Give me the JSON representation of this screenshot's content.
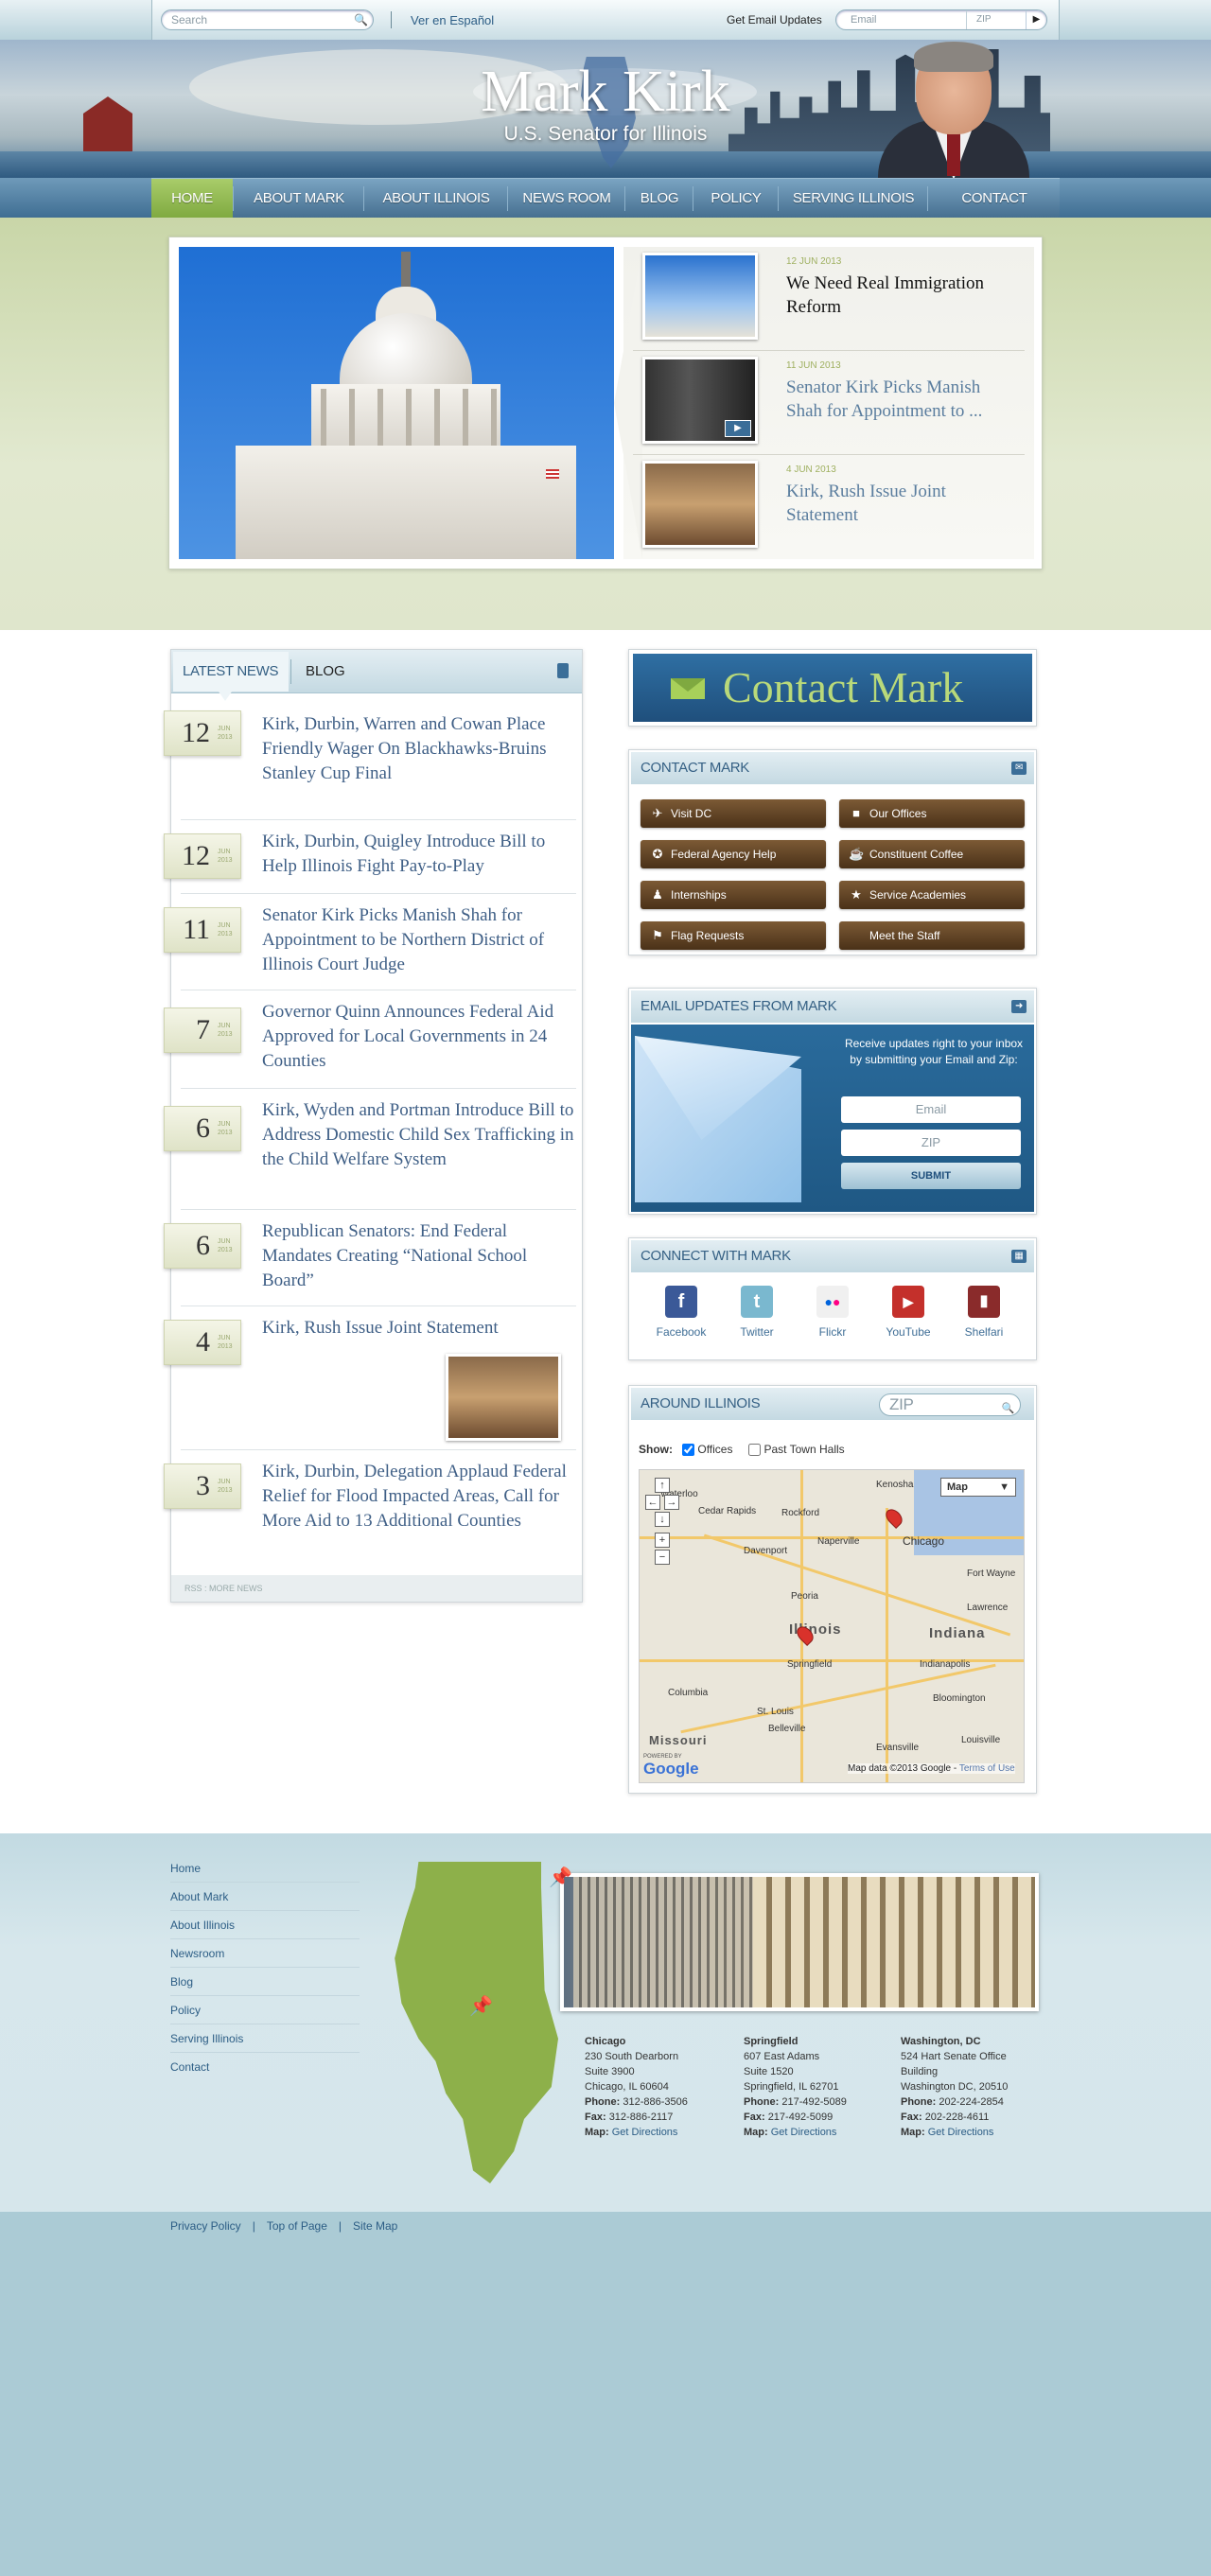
{
  "topbar": {
    "search_placeholder": "Search",
    "espanol": "Ver en Español",
    "email_label": "Get Email Updates",
    "email_placeholder": "Email",
    "zip_placeholder": "ZIP"
  },
  "header": {
    "name": "Mark Kirk",
    "tagline": "U.S. Senator for Illinois"
  },
  "nav": [
    "HOME",
    "ABOUT MARK",
    "ABOUT ILLINOIS",
    "NEWS ROOM",
    "BLOG",
    "POLICY",
    "SERVING ILLINOIS",
    "CONTACT"
  ],
  "featured": [
    {
      "date": "12 JUN 2013",
      "title": "We Need Real Immigration Reform"
    },
    {
      "date": "11 JUN 2013",
      "title": "Senator Kirk Picks Manish Shah for Appointment to ..."
    },
    {
      "date": "4 JUN 2013",
      "title": "Kirk, Rush Issue Joint Statement"
    }
  ],
  "news": {
    "tabs": {
      "latest": "LATEST NEWS",
      "blog": "BLOG"
    },
    "items": [
      {
        "day": "12",
        "mon": "JUN",
        "year": "2013",
        "title": "Kirk, Durbin, Warren and Cowan Place Friendly Wager On Blackhawks-Bruins Stanley Cup Final"
      },
      {
        "day": "12",
        "mon": "JUN",
        "year": "2013",
        "title": "Kirk, Durbin, Quigley Introduce Bill to Help Illinois Fight Pay-to-Play"
      },
      {
        "day": "11",
        "mon": "JUN",
        "year": "2013",
        "title": "Senator Kirk Picks Manish Shah for Appointment to be Northern District of Illinois Court Judge"
      },
      {
        "day": "7",
        "mon": "JUN",
        "year": "2013",
        "title": "Governor Quinn Announces Federal Aid Approved for Local Governments in 24 Counties"
      },
      {
        "day": "6",
        "mon": "JUN",
        "year": "2013",
        "title": "Kirk, Wyden and Portman Introduce Bill to Address Domestic Child Sex Trafficking in the Child Welfare System"
      },
      {
        "day": "6",
        "mon": "JUN",
        "year": "2013",
        "title": "Republican Senators: End Federal Mandates Creating “National School Board”"
      },
      {
        "day": "4",
        "mon": "JUN",
        "year": "2013",
        "title": "Kirk, Rush Issue Joint Statement"
      },
      {
        "day": "3",
        "mon": "JUN",
        "year": "2013",
        "title": "Kirk, Durbin, Delegation Applaud Federal Relief for Flood Impacted Areas, Call for More Aid to 13 Additional Counties"
      }
    ],
    "footer": "RSS : MORE NEWS"
  },
  "contact_banner": "Contact Mark",
  "contact": {
    "title": "CONTACT MARK",
    "buttons": [
      "Visit DC",
      "Our Offices",
      "Federal Agency Help",
      "Constituent Coffee",
      "Internships",
      "Service Academies",
      "Flag Requests",
      "Meet the Staff"
    ]
  },
  "email_updates": {
    "title": "EMAIL UPDATES FROM MARK",
    "text": "Receive updates right to your inbox by submitting your Email and Zip:",
    "email_placeholder": "Email",
    "zip_placeholder": "ZIP",
    "submit": "SUBMIT"
  },
  "connect": {
    "title": "CONNECT WITH  MARK",
    "items": [
      {
        "label": "Facebook",
        "icon": "facebook-icon",
        "color": "#3b5998",
        "glyph": "f"
      },
      {
        "label": "Twitter",
        "icon": "twitter-icon",
        "color": "#7ab8cf",
        "glyph": "t"
      },
      {
        "label": "Flickr",
        "icon": "flickr-icon",
        "color": "#f0f0f0",
        "glyph": "••"
      },
      {
        "label": "YouTube",
        "icon": "youtube-icon",
        "color": "#c4302b",
        "glyph": "▶"
      },
      {
        "label": "Shelfari",
        "icon": "shelfari-icon",
        "color": "#8a2b2b",
        "glyph": "▮"
      }
    ]
  },
  "around": {
    "title": "AROUND ILLINOIS",
    "zip_placeholder": "ZIP",
    "show_label": "Show:",
    "offices_label": "Offices",
    "past_label": "Past Town Halls",
    "map_type": "Map",
    "credit": "Map data ©2013 Google - ",
    "terms": "Terms of Use",
    "google": "Google",
    "powered": "POWERED BY",
    "cities": [
      "Waterloo",
      "Cedar Rapids",
      "Rockford",
      "Kenosha",
      "Naperville",
      "Chicago",
      "Davenport",
      "Peoria",
      "Illinois",
      "Springfield",
      "Fort Wayne",
      "Indiana",
      "Lawrence",
      "Indianapolis",
      "Columbia",
      "St. Louis",
      "Bloomington",
      "Belleville",
      "Evansville",
      "Louisville",
      "Missouri"
    ]
  },
  "footer": {
    "nav": [
      "Home",
      "About Mark",
      "About Illinois",
      "Newsroom",
      "Blog",
      "Policy",
      "Serving Illinois",
      "Contact"
    ],
    "offices": [
      {
        "name": "Chicago",
        "lines": [
          "230 South Dearborn",
          "Suite 3900",
          "Chicago, IL 60604"
        ],
        "phone": "312-886-3506",
        "fax": "312-886-2117",
        "map": "Get Directions"
      },
      {
        "name": "Springfield",
        "lines": [
          "607 East Adams",
          "Suite 1520",
          "Springfield, IL 62701"
        ],
        "phone": "217-492-5089",
        "fax": "217-492-5099",
        "map": "Get Directions"
      },
      {
        "name": "Washington, DC",
        "lines": [
          "524 Hart Senate Office",
          "Building",
          "Washington DC, 20510"
        ],
        "phone": "202-224-2854",
        "fax": "202-228-4611",
        "map": "Get Directions"
      }
    ],
    "labels": {
      "phone": "Phone:",
      "fax": "Fax:",
      "map": "Map:"
    },
    "bottom_links": [
      "Privacy Policy",
      "Top of Page",
      "Site Map"
    ]
  }
}
